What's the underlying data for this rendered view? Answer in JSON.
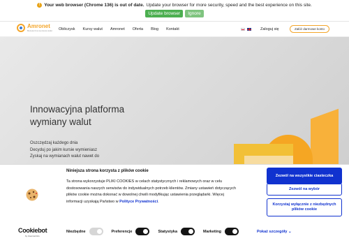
{
  "update_bar": {
    "title_bold": "Your web browser (Chrome 136) is out of date.",
    "message": "Update your browser for more security, speed and the best experience on this site.",
    "update_label": "Update browser",
    "ignore_label": "Ignore"
  },
  "nav": {
    "logo_name": "Amronet",
    "logo_tagline": "Bezpieczna wymiana walut",
    "menu": [
      "Obliczysk",
      "Kursy walut",
      "Amronet",
      "Oferta",
      "Blog",
      "Kontakt"
    ],
    "login_label": "Zaloguj się",
    "register_label": "Załóż darmowe konto"
  },
  "hero": {
    "title_line1": "Innowacyjna platforma",
    "title_line2": "wymiany walut",
    "points": [
      "Oszczędzaj każdego dnia",
      "Decyduj po jakim kursie wymieniasz",
      "Zyskaj na wymianach walut nawet do"
    ]
  },
  "cookie": {
    "title": "Niniejsza strona korzysta z plików cookie",
    "text_line1": "Ta strona wykorzystuje PLIKI COOKIES w celach statystycznych i reklamowych oraz w celu",
    "text_line2": "dostosowania naszych serwisów do indywidualnych potrzeb klientów. Zmiany ustawień dotyczących",
    "text_line3": "plików cookie można dokonać w dowolnej chwili modyfikując ustawienia przeglądarki. Więcej",
    "text_line4_prefix": "informacji uzyskają Państwo w ",
    "policy_link": "Polityce Prywatności",
    "text_line4_suffix": ".",
    "btn_allow_all": "Zezwól na wszystkie ciasteczka",
    "btn_allow_selection": "Zezwól na wybór",
    "btn_necessary": "Korzystaj wyłącznie z niezbędnych plików cookie",
    "cookiebot": "Cookiebot",
    "cookiebot_sub": "by Usercentrics",
    "toggles": [
      {
        "label": "Niezbędne",
        "state": "disabled"
      },
      {
        "label": "Preferencje",
        "state": "on"
      },
      {
        "label": "Statystyka",
        "state": "on"
      },
      {
        "label": "Marketing",
        "state": "on"
      }
    ],
    "details_label": "Pokaż szczegóły"
  }
}
